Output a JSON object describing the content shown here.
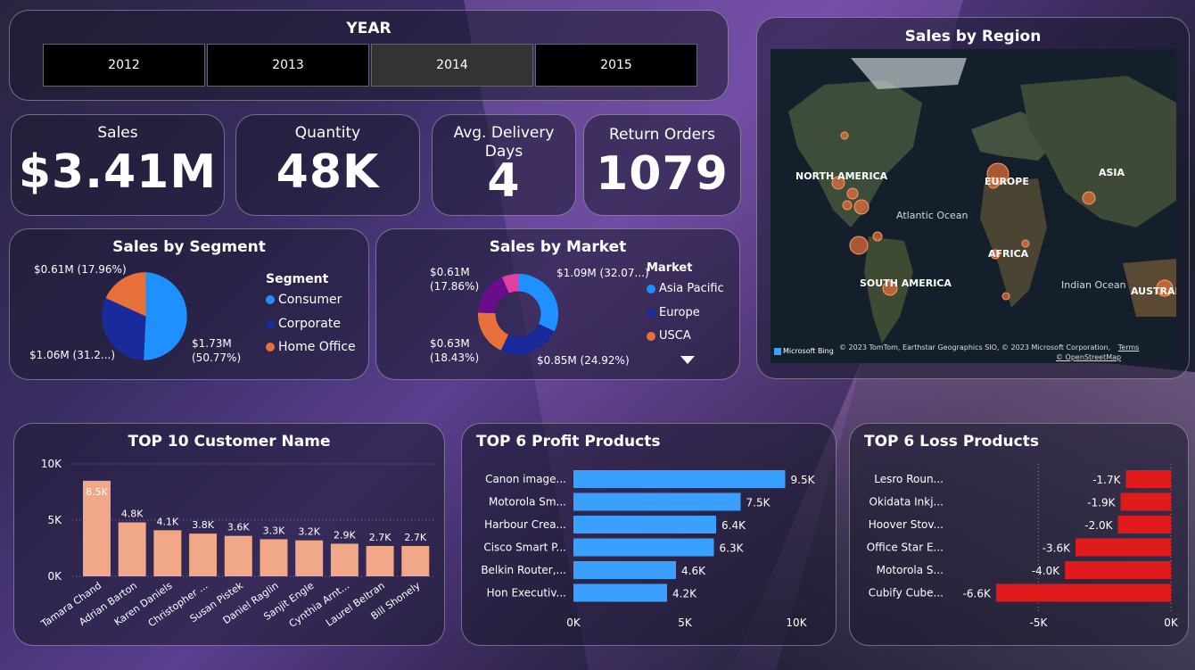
{
  "year_slicer": {
    "title": "YEAR",
    "years": [
      "2012",
      "2013",
      "2014",
      "2015"
    ],
    "selected": "2014"
  },
  "kpis": {
    "sales": {
      "label": "Sales",
      "value": "$3.41M"
    },
    "quantity": {
      "label": "Quantity",
      "value": "48K"
    },
    "delivery": {
      "label": "Avg. Delivery Days",
      "value": "4"
    },
    "returns": {
      "label": "Return Orders",
      "value": "1079"
    }
  },
  "segment": {
    "title": "Sales by Segment",
    "legend_title": "Segment",
    "legend": [
      "Consumer",
      "Corporate",
      "Home Office"
    ],
    "labels": [
      "$1.73M (50.77%)",
      "$1.06M (31.2...)",
      "$0.61M (17.96%)"
    ],
    "colors": [
      "#1e90ff",
      "#1a2a9a",
      "#e8703a"
    ]
  },
  "market": {
    "title": "Sales by Market",
    "legend_title": "Market",
    "legend": [
      "Asia Pacific",
      "Europe",
      "USCA"
    ],
    "labels": [
      "$1.09M (32.07...)",
      "$0.85M (24.92%)",
      "$0.63M (18.43%)",
      "$0.61M (17.86%)"
    ],
    "colors": [
      "#1e90ff",
      "#1a2a9a",
      "#e8703a",
      "#6a0d8a",
      "#e040a0"
    ]
  },
  "map": {
    "title": "Sales by Region",
    "labels": [
      "NORTH AMERICA",
      "EUROPE",
      "ASIA",
      "AFRICA",
      "SOUTH AMERICA",
      "AUSTRALIA",
      "Atlantic Ocean",
      "Indian Ocean"
    ],
    "attribution": "© 2023 TomTom, Earthstar Geographics SIO, © 2023 Microsoft Corporation,",
    "terms": "Terms",
    "osm": "© OpenStreetMap",
    "bing": "Microsoft Bing"
  },
  "chart_data": [
    {
      "type": "bar",
      "title": "TOP 10 Customer Name",
      "categories": [
        "Tamara Chand",
        "Adrian Barton",
        "Karen Daniels",
        "Christopher ...",
        "Susan Pistek",
        "Daniel Raglin",
        "Sanjit Engle",
        "Cynthia Arnt...",
        "Laurel Beltran",
        "Bill Shonely"
      ],
      "values": [
        8.5,
        4.8,
        4.1,
        3.8,
        3.6,
        3.3,
        3.2,
        2.9,
        2.7,
        2.7
      ],
      "labels": [
        "8.5K",
        "4.8K",
        "4.1K",
        "3.8K",
        "3.6K",
        "3.3K",
        "3.2K",
        "2.9K",
        "2.7K",
        "2.7K"
      ],
      "yticks": [
        "10K",
        "5K",
        "0K"
      ],
      "ylim": [
        0,
        10
      ],
      "color": "#f0a888"
    },
    {
      "type": "bar",
      "title": "TOP 6 Profit Products",
      "categories": [
        "Canon image...",
        "Motorola Sm...",
        "Harbour Crea...",
        "Cisco Smart P...",
        "Belkin Router,...",
        "Hon Executiv..."
      ],
      "values": [
        9.5,
        7.5,
        6.4,
        6.3,
        4.6,
        4.2
      ],
      "labels": [
        "9.5K",
        "7.5K",
        "6.4K",
        "6.3K",
        "4.6K",
        "4.2K"
      ],
      "xticks": [
        "0K",
        "5K",
        "10K"
      ],
      "xlim": [
        0,
        10
      ],
      "color": "#3aa0ff"
    },
    {
      "type": "bar",
      "title": "TOP 6 Loss Products",
      "categories": [
        "Lesro Roun...",
        "Okidata Inkj...",
        "Hoover Stov...",
        "Office Star E...",
        "Motorola S...",
        "Cubify Cube..."
      ],
      "values": [
        -1.7,
        -1.9,
        -2.0,
        -3.6,
        -4.0,
        -6.6
      ],
      "labels": [
        "-1.7K",
        "-1.9K",
        "-2.0K",
        "-3.6K",
        "-4.0K",
        "-6.6K"
      ],
      "xticks": [
        "-5K",
        "0K"
      ],
      "xlim": [
        -7,
        0
      ],
      "color": "#e01b1b"
    }
  ]
}
